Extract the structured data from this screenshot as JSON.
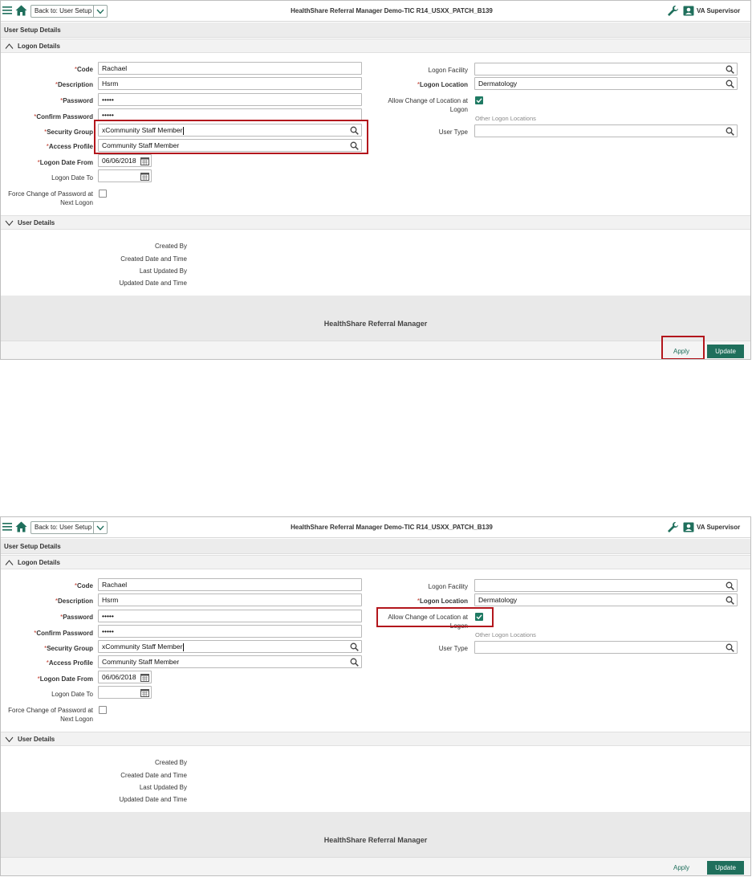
{
  "screens": [
    {
      "app_title": "HealthShare Referral Manager Demo-TIC R14_USXX_PATCH_B139",
      "back_label": "Back to: User Setup",
      "user_name": "VA Supervisor",
      "section_bar": "User Setup Details",
      "logon_section": "Logon Details",
      "labels": {
        "code": "Code",
        "description": "Description",
        "password": "Password",
        "confirm_password": "Confirm Password",
        "security_group": "Security Group",
        "access_profile": "Access Profile",
        "logon_date_from": "Logon Date From",
        "logon_date_to": "Logon Date To",
        "force_change": "Force Change of Password at Next Logon",
        "logon_facility": "Logon Facility",
        "logon_location": "Logon Location",
        "allow_change": "Allow Change of Location at Logon",
        "other_locations": "Other Logon Locations",
        "user_type": "User Type"
      },
      "values": {
        "code": "Rachael",
        "description": "Hsrm",
        "password": "•••••",
        "confirm_password": "•••••",
        "security_group": "xCommunity Staff Member",
        "access_profile": "Community Staff Member",
        "logon_date_from": "06/06/2018",
        "logon_date_to": "",
        "logon_facility": "",
        "logon_location": "Dermatology",
        "user_type": ""
      },
      "force_change_checked": false,
      "allow_change_checked": true,
      "user_section": "User Details",
      "user_detail_labels": [
        "Created By",
        "Created Date and Time",
        "Last Updated By",
        "Updated Date and Time"
      ],
      "footer": "HealthShare Referral Manager",
      "apply_label": "Apply",
      "update_label": "Update",
      "highlights": [
        "security-group-and-access-profile",
        "apply-button"
      ]
    },
    {
      "app_title": "HealthShare Referral Manager Demo-TIC R14_USXX_PATCH_B139",
      "back_label": "Back to: User Setup",
      "user_name": "VA Supervisor",
      "section_bar": "User Setup Details",
      "logon_section": "Logon Details",
      "labels": {
        "code": "Code",
        "description": "Description",
        "password": "Password",
        "confirm_password": "Confirm Password",
        "security_group": "Security Group",
        "access_profile": "Access Profile",
        "logon_date_from": "Logon Date From",
        "logon_date_to": "Logon Date To",
        "force_change": "Force Change of Password at Next Logon",
        "logon_facility": "Logon Facility",
        "logon_location": "Logon Location",
        "allow_change": "Allow Change of Location at Logon",
        "other_locations": "Other Logon Locations",
        "user_type": "User Type"
      },
      "values": {
        "code": "Rachael",
        "description": "Hsrm",
        "password": "•••••",
        "confirm_password": "•••••",
        "security_group": "xCommunity Staff Member",
        "access_profile": "Community Staff Member",
        "logon_date_from": "06/06/2018",
        "logon_date_to": "",
        "logon_facility": "",
        "logon_location": "Dermatology",
        "user_type": ""
      },
      "force_change_checked": false,
      "allow_change_checked": true,
      "user_section": "User Details",
      "user_detail_labels": [
        "Created By",
        "Created Date and Time",
        "Last Updated By",
        "Updated Date and Time"
      ],
      "footer": "HealthShare Referral Manager",
      "apply_label": "Apply",
      "update_label": "Update",
      "highlights": [
        "allow-change-location-checkbox"
      ]
    }
  ],
  "doc_link": "",
  "colors": {
    "accent": "#1f6f5c",
    "highlight": "#b3161c",
    "required": "#c0392b"
  }
}
